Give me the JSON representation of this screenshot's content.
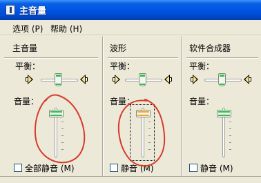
{
  "window": {
    "title": "主音量"
  },
  "menu": {
    "options": "选项 (P)",
    "help": "帮助 (H)"
  },
  "columns": [
    {
      "title": "主音量",
      "balance_label": "平衡：",
      "volume_label": "音量：",
      "mute_label": "全部静音 (M)",
      "mute_checked": false,
      "balance": 0.5,
      "volume": 0.8
    },
    {
      "title": "波形",
      "balance_label": "平衡：",
      "volume_label": "音量：",
      "mute_label": "静音 (M)",
      "mute_checked": false,
      "balance": 0.5,
      "volume": 0.8,
      "focused": true
    },
    {
      "title": "软件合成器",
      "balance_label": "平衡：",
      "volume_label": "音量：",
      "mute_label": "静音 (M)",
      "mute_checked": false,
      "balance": 0.5,
      "volume": 0.8
    }
  ],
  "colors": {
    "annotation": "#d83a2a",
    "slider_accent": "#34c04a",
    "focus_accent": "#f0a92a"
  },
  "icons": {
    "balance_left": "speaker-left-icon",
    "balance_right": "speaker-right-icon",
    "app": "volume-control-icon"
  }
}
